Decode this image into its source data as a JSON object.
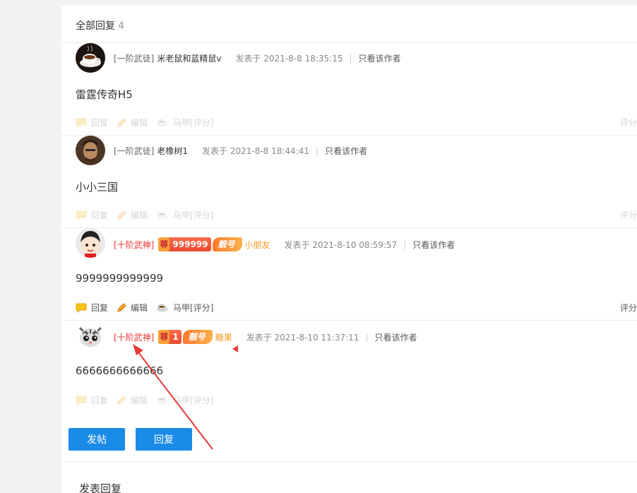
{
  "replies_header": {
    "label": "全部回复",
    "count": "4"
  },
  "posts": [
    {
      "rank": "[一阶武徒]",
      "username": "米老鼠和蓝精鼠v",
      "time": "发表于 2021-8-8 18:35:15",
      "only_author": "只看该作者",
      "content": "雷霆传奇H5",
      "actions": {
        "reply": "回复",
        "edit": "编辑",
        "rate": "马甲[评分]"
      },
      "score": "评分"
    },
    {
      "rank": "[一阶武徒]",
      "username": "老橡树1",
      "time": "发表于 2021-8-8 18:44:41",
      "only_author": "只看该作者",
      "content": "小小三国",
      "actions": {
        "reply": "回复",
        "edit": "编辑",
        "rate": "马甲[评分]"
      },
      "score": "评分"
    },
    {
      "rank": "[十阶武神]",
      "badge_zun": "尊",
      "badge_num": "999999",
      "badge_liang": "靓号",
      "username": "小朋友",
      "time": "发表于 2021-8-10 08:59:57",
      "only_author": "只看该作者",
      "content": "9999999999999",
      "actions": {
        "reply": "回复",
        "edit": "编辑",
        "rate": "马甲[评分]"
      },
      "score": "评分"
    },
    {
      "rank": "[十阶武神]",
      "badge_zun": "尊",
      "badge_num": "1",
      "badge_liang": "靓号",
      "username": "糖果",
      "time": "发表于 2021-8-10 11:37:11",
      "only_author": "只看该作者",
      "content": "6666666666666",
      "actions": {
        "reply": "回复",
        "edit": "编辑",
        "rate": "马甲[评分]"
      },
      "score": ""
    }
  ],
  "buttons": {
    "new_post": "发帖",
    "reply": "回复"
  },
  "reply_section_title": "发表回复",
  "colors": {
    "accent_blue": "#1b8be8",
    "rank_red": "#e33333",
    "arrow_red": "#e83a3a"
  }
}
